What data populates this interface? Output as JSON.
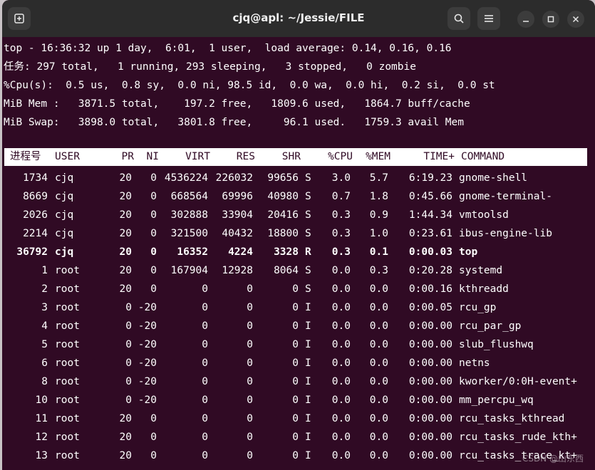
{
  "window": {
    "title": "cjq@apl: ~/Jessie/FILE"
  },
  "summary": {
    "line1": "top - 16:36:32 up 1 day,  6:01,  1 user,  load average: 0.14, 0.16, 0.16",
    "line2": "任务: 297 total,   1 running, 293 sleeping,   3 stopped,   0 zombie",
    "line3": "%Cpu(s):  0.5 us,  0.8 sy,  0.0 ni, 98.5 id,  0.0 wa,  0.0 hi,  0.2 si,  0.0 st",
    "line4": "MiB Mem :   3871.5 total,    197.2 free,   1809.6 used,   1864.7 buff/cache",
    "line5": "MiB Swap:   3898.0 total,   3801.8 free,     96.1 used.   1759.3 avail Mem"
  },
  "columns": {
    "pid": "进程号",
    "user": "USER",
    "pr": "PR",
    "ni": "NI",
    "virt": "VIRT",
    "res": "RES",
    "shr": "SHR",
    "s": "",
    "cpu": "%CPU",
    "mem": "%MEM",
    "time": "TIME+",
    "command": "COMMAND"
  },
  "processes": [
    {
      "pid": "1734",
      "user": "cjq",
      "pr": "20",
      "ni": "0",
      "virt": "4536224",
      "res": "226032",
      "shr": "99656",
      "s": "S",
      "cpu": "3.0",
      "mem": "5.7",
      "time": "6:19.23",
      "command": "gnome-shell"
    },
    {
      "pid": "8669",
      "user": "cjq",
      "pr": "20",
      "ni": "0",
      "virt": "668564",
      "res": "69996",
      "shr": "40980",
      "s": "S",
      "cpu": "0.7",
      "mem": "1.8",
      "time": "0:45.66",
      "command": "gnome-terminal-"
    },
    {
      "pid": "2026",
      "user": "cjq",
      "pr": "20",
      "ni": "0",
      "virt": "302888",
      "res": "33904",
      "shr": "20416",
      "s": "S",
      "cpu": "0.3",
      "mem": "0.9",
      "time": "1:44.34",
      "command": "vmtoolsd"
    },
    {
      "pid": "2214",
      "user": "cjq",
      "pr": "20",
      "ni": "0",
      "virt": "321500",
      "res": "40432",
      "shr": "18800",
      "s": "S",
      "cpu": "0.3",
      "mem": "1.0",
      "time": "0:23.61",
      "command": "ibus-engine-lib"
    },
    {
      "pid": "36792",
      "user": "cjq",
      "pr": "20",
      "ni": "0",
      "virt": "16352",
      "res": "4224",
      "shr": "3328",
      "s": "R",
      "cpu": "0.3",
      "mem": "0.1",
      "time": "0:00.03",
      "command": "top",
      "bold": true
    },
    {
      "pid": "1",
      "user": "root",
      "pr": "20",
      "ni": "0",
      "virt": "167904",
      "res": "12928",
      "shr": "8064",
      "s": "S",
      "cpu": "0.0",
      "mem": "0.3",
      "time": "0:20.28",
      "command": "systemd"
    },
    {
      "pid": "2",
      "user": "root",
      "pr": "20",
      "ni": "0",
      "virt": "0",
      "res": "0",
      "shr": "0",
      "s": "S",
      "cpu": "0.0",
      "mem": "0.0",
      "time": "0:00.16",
      "command": "kthreadd"
    },
    {
      "pid": "3",
      "user": "root",
      "pr": "0",
      "ni": "-20",
      "virt": "0",
      "res": "0",
      "shr": "0",
      "s": "I",
      "cpu": "0.0",
      "mem": "0.0",
      "time": "0:00.05",
      "command": "rcu_gp"
    },
    {
      "pid": "4",
      "user": "root",
      "pr": "0",
      "ni": "-20",
      "virt": "0",
      "res": "0",
      "shr": "0",
      "s": "I",
      "cpu": "0.0",
      "mem": "0.0",
      "time": "0:00.00",
      "command": "rcu_par_gp"
    },
    {
      "pid": "5",
      "user": "root",
      "pr": "0",
      "ni": "-20",
      "virt": "0",
      "res": "0",
      "shr": "0",
      "s": "I",
      "cpu": "0.0",
      "mem": "0.0",
      "time": "0:00.00",
      "command": "slub_flushwq"
    },
    {
      "pid": "6",
      "user": "root",
      "pr": "0",
      "ni": "-20",
      "virt": "0",
      "res": "0",
      "shr": "0",
      "s": "I",
      "cpu": "0.0",
      "mem": "0.0",
      "time": "0:00.00",
      "command": "netns"
    },
    {
      "pid": "8",
      "user": "root",
      "pr": "0",
      "ni": "-20",
      "virt": "0",
      "res": "0",
      "shr": "0",
      "s": "I",
      "cpu": "0.0",
      "mem": "0.0",
      "time": "0:00.00",
      "command": "kworker/0:0H-event+"
    },
    {
      "pid": "10",
      "user": "root",
      "pr": "0",
      "ni": "-20",
      "virt": "0",
      "res": "0",
      "shr": "0",
      "s": "I",
      "cpu": "0.0",
      "mem": "0.0",
      "time": "0:00.00",
      "command": "mm_percpu_wq"
    },
    {
      "pid": "11",
      "user": "root",
      "pr": "20",
      "ni": "0",
      "virt": "0",
      "res": "0",
      "shr": "0",
      "s": "I",
      "cpu": "0.0",
      "mem": "0.0",
      "time": "0:00.00",
      "command": "rcu_tasks_kthread"
    },
    {
      "pid": "12",
      "user": "root",
      "pr": "20",
      "ni": "0",
      "virt": "0",
      "res": "0",
      "shr": "0",
      "s": "I",
      "cpu": "0.0",
      "mem": "0.0",
      "time": "0:00.00",
      "command": "rcu_tasks_rude_kth+"
    },
    {
      "pid": "13",
      "user": "root",
      "pr": "20",
      "ni": "0",
      "virt": "0",
      "res": "0",
      "shr": "0",
      "s": "I",
      "cpu": "0.0",
      "mem": "0.0",
      "time": "0:00.00",
      "command": "rcu_tasks_trace_kt+"
    }
  ],
  "watermark": "CSDN @山东西",
  "icons": {
    "new_tab": "new-tab-icon",
    "search": "search-icon",
    "menu": "hamburger-menu-icon",
    "minimize": "minimize-icon",
    "maximize": "maximize-icon",
    "close": "close-icon"
  },
  "colors": {
    "terminal_bg": "#300a24",
    "titlebar_bg": "#2c2c2c",
    "header_bg": "#ffffff"
  }
}
